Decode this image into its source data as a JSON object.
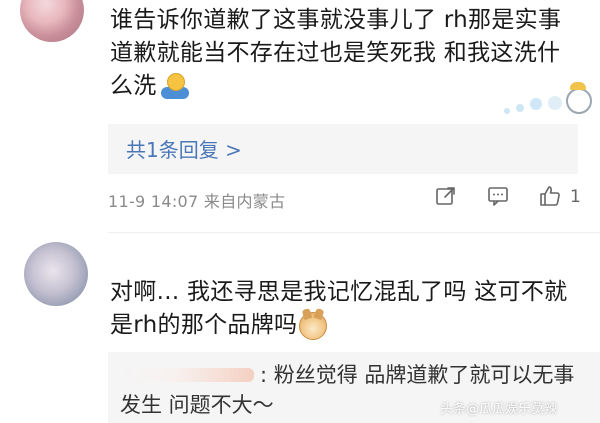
{
  "comments": [
    {
      "text_part1": "谁告诉你道歉了这事就没事儿了 rh那是实事道歉就能当不存在过也是笑死我 和我这洗什么洗",
      "emoji_after": "shrug-emoji",
      "reply_summary": "共1条回复 >",
      "meta": "11-9 14:07 来自内蒙古",
      "like_count": "1"
    },
    {
      "text_part1": "对啊... 我还寻思是我记忆混乱了吗 这可不就是rh的那个品牌吗",
      "emoji_after": "doge-emoji",
      "quote_text": ": 粉丝觉得 品牌道歉了就可以无事发生 问题不大～"
    }
  ],
  "watermark": "头条@瓜瓜娱乐莫辣",
  "colors": {
    "link": "#4a77b8",
    "meta": "#8a8a8a",
    "panel": "#f5f5f5"
  }
}
